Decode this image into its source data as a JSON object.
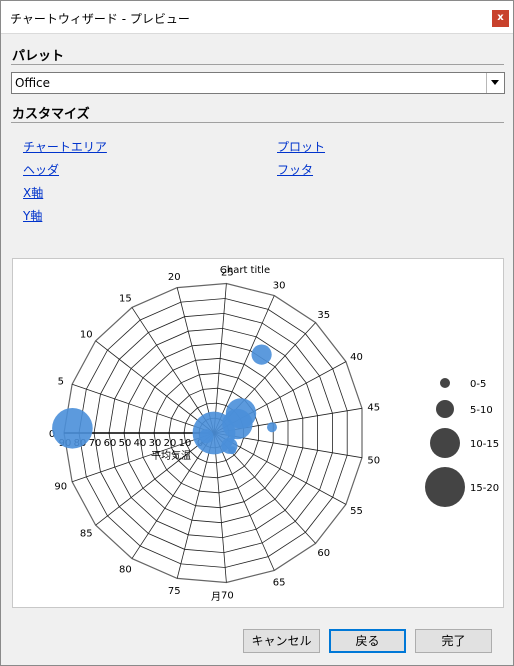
{
  "window": {
    "title": "チャートウィザード - プレビュー",
    "close_label": "x"
  },
  "palette": {
    "heading": "パレット",
    "selected": "Office"
  },
  "customize": {
    "heading": "カスタマイズ",
    "links": {
      "chart_area": "チャートエリア",
      "plot": "プロット",
      "header": "ヘッダ",
      "footer": "フッタ",
      "x_axis": "X軸",
      "y_axis": "Y軸"
    }
  },
  "buttons": {
    "cancel": "キャンセル",
    "back": "戻る",
    "finish": "完了"
  },
  "colors": {
    "bubble": "#4a8fd9",
    "legend_bubble": "#444444",
    "close": "#c8412c"
  },
  "chart_data": {
    "type": "bubble-polar",
    "title": "Chart title",
    "xlabel": "月",
    "ylabel": "平均気温",
    "angle_ticks": [
      "0",
      "5",
      "10",
      "15",
      "20",
      "25",
      "30",
      "35",
      "40",
      "45",
      "50",
      "55",
      "60",
      "65",
      "70",
      "75",
      "80",
      "85",
      "90"
    ],
    "radial_ticks": [
      "90",
      "80",
      "70",
      "60",
      "50",
      "40",
      "30",
      "20",
      "10",
      "0"
    ],
    "series": [
      {
        "points": [
          {
            "x": 0.5,
            "y": 5,
            "size": 17
          },
          {
            "x": 8,
            "y": 90,
            "size": 18
          },
          {
            "x": 89,
            "y": 85,
            "size": 4
          },
          {
            "x": 32,
            "y": 35,
            "size": 7
          },
          {
            "x": 38,
            "y": 70,
            "size": 12
          },
          {
            "x": 42,
            "y": 75,
            "size": 12
          },
          {
            "x": 46,
            "y": 55,
            "size": 2
          },
          {
            "x": 58,
            "y": 78,
            "size": 5
          },
          {
            "x": 59,
            "y": 75,
            "size": 1
          }
        ]
      }
    ],
    "legend": [
      "0-5",
      "5-10",
      "10-15",
      "15-20"
    ],
    "legend_position": "right"
  }
}
